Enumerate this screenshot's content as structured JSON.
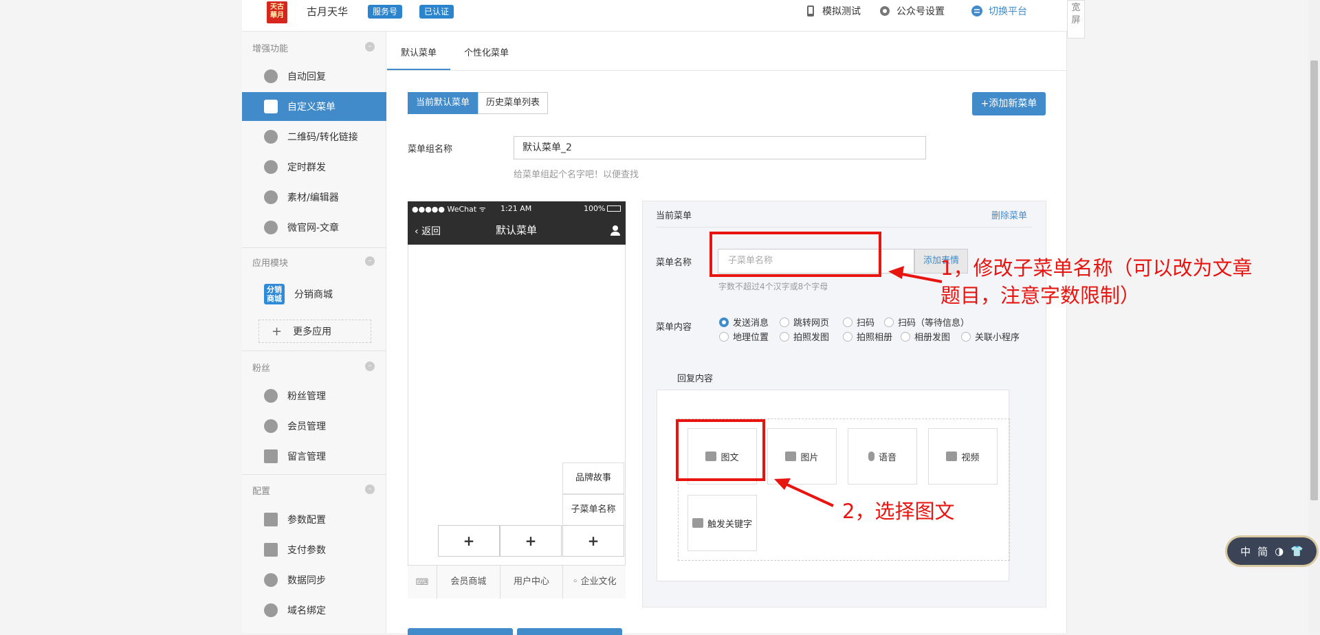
{
  "header": {
    "logo_text": "天古\n華月",
    "account_name": "古月天华",
    "badge_service": "服务号",
    "badge_verified": "已认证",
    "links": [
      "模拟测试",
      "公众号设置",
      "切换平台"
    ],
    "wide_screen_label": "宽\n屏"
  },
  "sidebar": {
    "groups": [
      {
        "title": "增强功能",
        "items": [
          "自动回复",
          "自定义菜单",
          "二维码/转化链接",
          "定时群发",
          "素材/编辑器",
          "微官网-文章"
        ]
      },
      {
        "title": "应用模块",
        "items": [
          "分销商城",
          "更多应用"
        ]
      },
      {
        "title": "粉丝",
        "items": [
          "粉丝管理",
          "会员管理",
          "留言管理"
        ]
      },
      {
        "title": "配置",
        "items": [
          "参数配置",
          "支付参数",
          "数据同步",
          "域名绑定"
        ]
      }
    ],
    "active_item": "自定义菜单",
    "app_icon_text": "分销\n商城",
    "collapse_symbol": "–",
    "plus_symbol": "+"
  },
  "tabs": [
    "默认菜单",
    "个性化菜单"
  ],
  "segment": [
    "当前默认菜单",
    "历史菜单列表"
  ],
  "add_button": "+添加新菜单",
  "menu_group": {
    "label": "菜单组名称",
    "value": "默认菜单_2",
    "hint": "给菜单组起个名字吧！以便查找"
  },
  "phone": {
    "carrier": "●●●●● WeChat ᯤ",
    "time": "1:21 AM",
    "battery": "100%",
    "back": "返回",
    "title": "默认菜单",
    "submenu_items": [
      "品牌故事",
      "子菜单名称"
    ],
    "plus": "+",
    "keyboard_icon": "⌨",
    "footer_items": [
      "会员商城",
      "用户中心",
      "企业文化"
    ]
  },
  "editor": {
    "title": "当前菜单",
    "delete": "删除菜单",
    "name_label": "菜单名称",
    "name_placeholder": "子菜单名称",
    "emoji_button": "添加表情",
    "name_hint": "字数不超过4个汉字或8个字母",
    "content_label": "菜单内容",
    "radio_options": [
      "发送消息",
      "跳转网页",
      "扫码",
      "扫码（等待信息）",
      "地理位置",
      "拍照发图",
      "拍照相册",
      "相册发图",
      "关联小程序"
    ],
    "selected_option": "发送消息",
    "reply_title": "回复内容",
    "reply_types": [
      "图文",
      "图片",
      "语音",
      "视频",
      "触发关键字"
    ]
  },
  "annotations": {
    "step1": "1，修改子菜单名称（可以改为文章\n题目，注意字数限制）",
    "step2": "2，选择图文"
  },
  "ime": {
    "items": [
      "中",
      "简",
      "◑",
      "👕"
    ]
  },
  "colors": {
    "accent": "#428bca",
    "annotation": "#e8140f",
    "phone_header": "#2e2e2e"
  }
}
